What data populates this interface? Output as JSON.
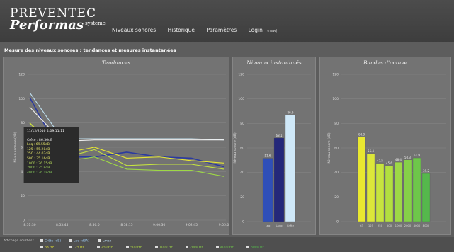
{
  "brand": {
    "line1": "PREVENTEC",
    "line2": "Performas",
    "sup": "systeme"
  },
  "nav": {
    "items": [
      "Niveaux sonores",
      "Historique",
      "Paramètres",
      "Login"
    ],
    "small": "(new)"
  },
  "page_title": "Mesure des niveaux sonores : tendances et mesures instantanées",
  "panels": {
    "tendances": "Tendances",
    "instant": "Niveaux instantanés",
    "octave": "Bandes d'octave"
  },
  "tendances": {
    "ylabel": "Niveau sonore (dB)",
    "yticks": [
      "120",
      "100",
      "80",
      "60",
      "40",
      "20",
      "0"
    ],
    "xticks": [
      "8:51:30",
      "8:53:45",
      "8:56:0",
      "8:58:15",
      "9:00:30",
      "9:02:45",
      "9:05:0"
    ],
    "tooltip": {
      "time": "11/12/2016 4:09:11:11",
      "lines": [
        "Crête : 86.36dB",
        "Leq : 69.55dB",
        "125 : 55.28dB",
        "250 : 44.02dB",
        "500 : 35.16dB",
        "1000 : 36.15dB",
        "2000 : 35.8dB",
        "4000 : 36.18dB"
      ]
    }
  },
  "instant": {
    "ylabel": "Niveau sonore (dB)",
    "yticks": [
      "120",
      "100",
      "80",
      "60",
      "40",
      "20",
      "0"
    ],
    "categories": [
      "Leq",
      "Lavg",
      "Crête"
    ],
    "values": [
      51.6,
      68.1,
      86.9
    ],
    "labels": [
      "51.6",
      "68.1",
      "86.9"
    ],
    "colors": [
      "#2f4fb8",
      "#24287a",
      "#cfe8f8"
    ]
  },
  "octave": {
    "ylabel": "Niveau sonore (dB)",
    "yticks": [
      "120",
      "100",
      "80",
      "60",
      "40",
      "20",
      "0"
    ],
    "categories": [
      "63",
      "125",
      "250",
      "500",
      "1000",
      "2000",
      "4000",
      "8000"
    ],
    "values": [
      68.8,
      55.4,
      47.5,
      45.6,
      48.4,
      50.3,
      51.9,
      39.2
    ],
    "labels": [
      "68.8",
      "55.4",
      "47.5",
      "45.6",
      "48.4",
      "50.3",
      "51.9",
      "39.2"
    ],
    "colors": [
      "#e9e830",
      "#dce73a",
      "#c6e43f",
      "#b2df40",
      "#9ed846",
      "#86d048",
      "#6ec64a",
      "#55b84c"
    ]
  },
  "footer": {
    "label": "Affichage courbes :",
    "row1": [
      "Crête (dB)",
      "Leq (dBA)",
      "Lmax"
    ],
    "row2": [
      "63 Hz",
      "125 Hz",
      "250 Hz",
      "500 Hz",
      "1000 Hz",
      "2000 Hz",
      "4000 Hz",
      "8000 Hz"
    ]
  },
  "chart_data": [
    {
      "type": "line",
      "title": "Tendances",
      "ylabel": "Niveau sonore (dB)",
      "x": [
        "8:51:30",
        "8:53:45",
        "8:56:0",
        "8:58:15",
        "9:00:30",
        "9:02:45",
        "9:05:0"
      ],
      "ylim": [
        0,
        120
      ],
      "series": [
        {
          "name": "Crête",
          "values": [
            105,
            67,
            67,
            67,
            67,
            67,
            66
          ]
        },
        {
          "name": "Leq",
          "values": [
            101,
            52,
            52,
            56,
            52,
            51,
            44
          ]
        },
        {
          "name": "Lmax",
          "values": [
            93,
            65,
            66,
            66,
            66,
            66,
            66
          ]
        },
        {
          "name": "125",
          "values": [
            80,
            55,
            60,
            51,
            52,
            49,
            47
          ]
        },
        {
          "name": "250",
          "values": [
            80,
            51,
            58,
            45,
            46,
            46,
            42
          ]
        },
        {
          "name": "500",
          "values": [
            72,
            48,
            52,
            42,
            41,
            41,
            36
          ]
        }
      ]
    },
    {
      "type": "bar",
      "title": "Niveaux instantanés",
      "ylabel": "Niveau sonore (dB)",
      "categories": [
        "Leq",
        "Lavg",
        "Crête"
      ],
      "values": [
        51.6,
        68.1,
        86.9
      ],
      "ylim": [
        0,
        120
      ]
    },
    {
      "type": "bar",
      "title": "Bandes d'octave",
      "ylabel": "Niveau sonore (dB)",
      "categories": [
        "63",
        "125",
        "250",
        "500",
        "1000",
        "2000",
        "4000",
        "8000"
      ],
      "values": [
        68.8,
        55.4,
        47.5,
        45.6,
        48.4,
        50.3,
        51.9,
        39.2
      ],
      "ylim": [
        0,
        120
      ]
    }
  ]
}
